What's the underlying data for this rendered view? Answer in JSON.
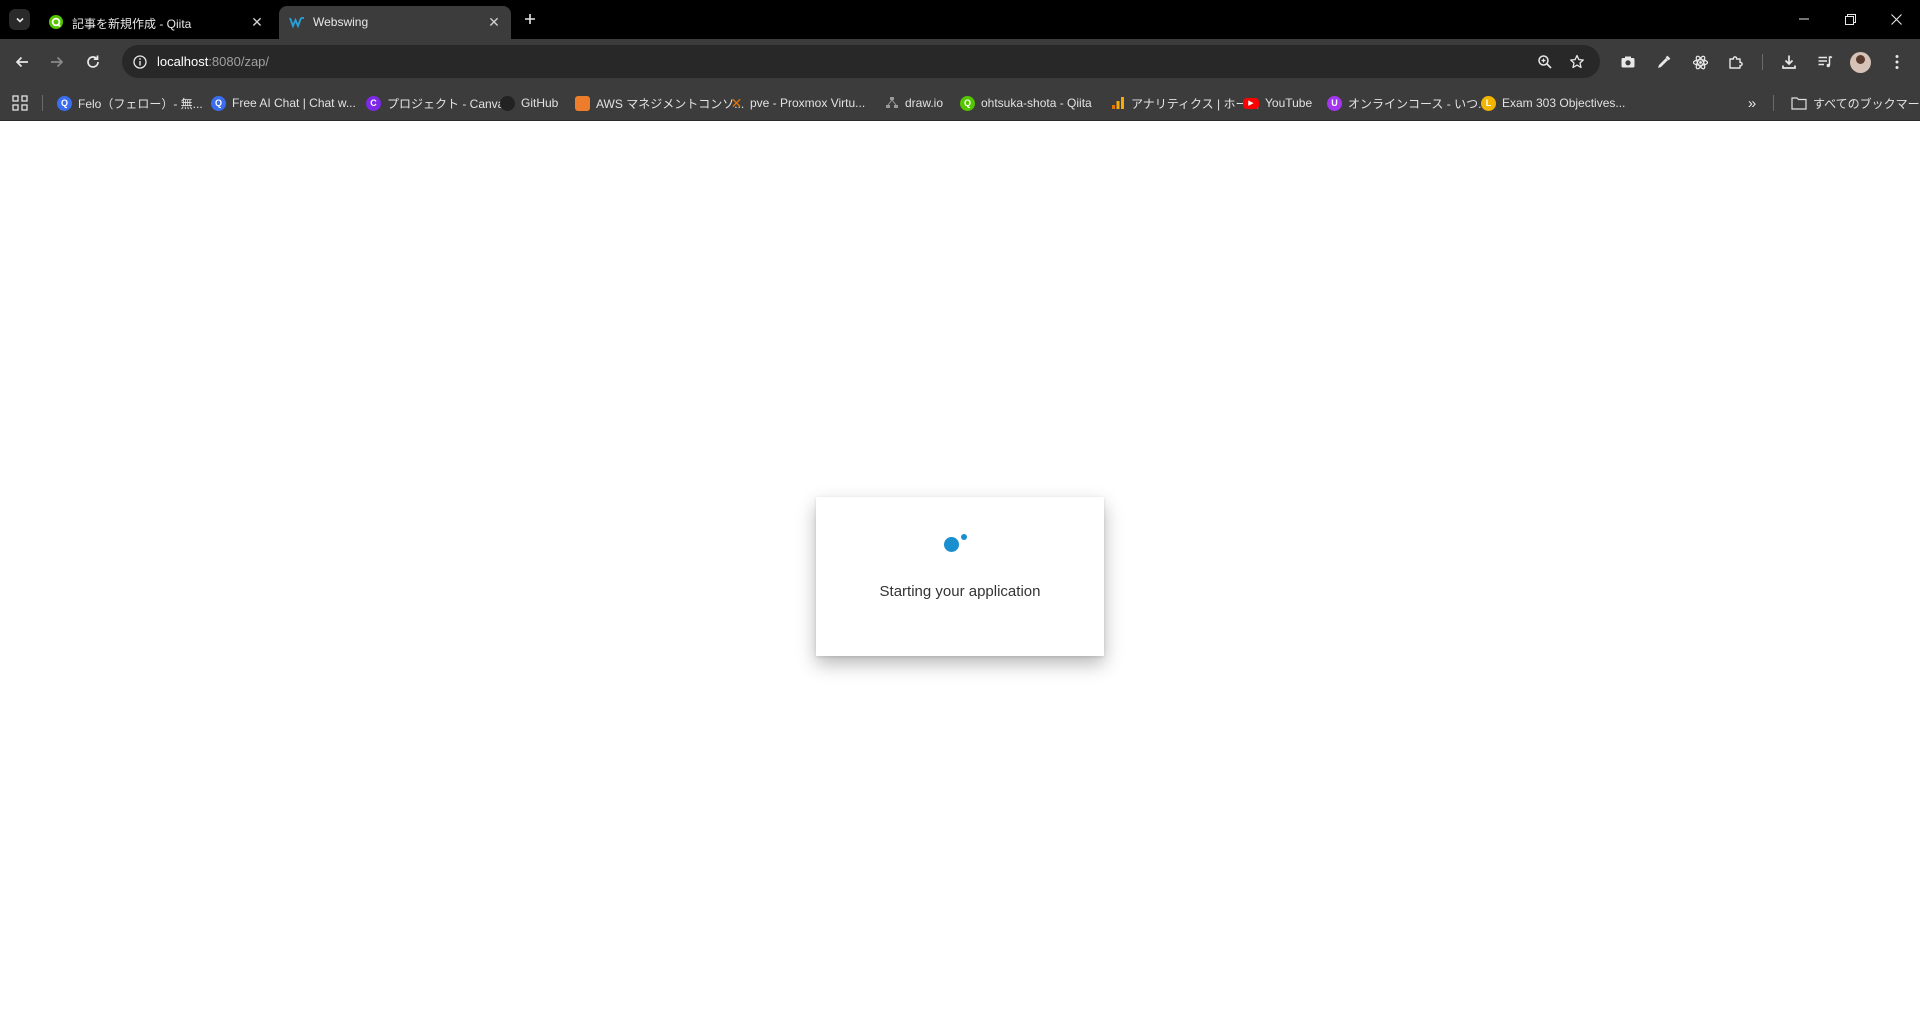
{
  "tabs": [
    {
      "title": "記事を新規作成 - Qiita",
      "favicon": "qiita-icon",
      "active": false
    },
    {
      "title": "Webswing",
      "favicon": "webswing-icon",
      "active": true
    }
  ],
  "address_bar": {
    "host": "localhost",
    "path": ":8080/zap/"
  },
  "bookmarks": [
    {
      "label": "Felo（フェロー）- 無...",
      "icon": "felo-icon",
      "color": "#3a6df0"
    },
    {
      "label": "Free AI Chat | Chat w...",
      "icon": "chat-icon",
      "color": "#3a6df0"
    },
    {
      "label": "プロジェクト - Canva",
      "icon": "canva-icon",
      "color": "#7d2ae8"
    },
    {
      "label": "GitHub",
      "icon": "github-icon",
      "color": "#222222"
    },
    {
      "label": "AWS マネジメントコンソ...",
      "icon": "aws-icon",
      "color": "#ed7d2b"
    },
    {
      "label": "pve - Proxmox Virtu...",
      "icon": "proxmox-icon",
      "color": "#e57000"
    },
    {
      "label": "draw.io",
      "icon": "drawio-icon",
      "color": "#9a9a9a"
    },
    {
      "label": "ohtsuka-shota - Qiita",
      "icon": "qiita-icon",
      "color": "#55c500"
    },
    {
      "label": "アナリティクス | ホーム",
      "icon": "analytics-icon",
      "color": "#f9ab00"
    },
    {
      "label": "YouTube",
      "icon": "youtube-icon",
      "color": "#ff0000"
    },
    {
      "label": "オンラインコース - いつ...",
      "icon": "udemy-icon",
      "color": "#a435f0"
    },
    {
      "label": "Exam 303 Objectives...",
      "icon": "lpi-icon",
      "color": "#f2b600"
    }
  ],
  "all_bookmarks_label": "すべてのブックマーク",
  "dialog": {
    "message": "Starting your application",
    "spinner_color": "#1a8fd0"
  },
  "colors": {
    "tabstrip": "#000000",
    "toolbar": "#3c3c3c",
    "omnibox": "#282828"
  }
}
